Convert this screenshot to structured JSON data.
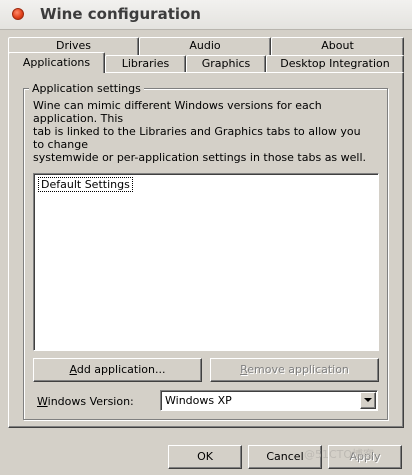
{
  "window": {
    "title": "Wine configuration"
  },
  "tabs": {
    "row1": [
      {
        "label": "Drives"
      },
      {
        "label": "Audio"
      },
      {
        "label": "About"
      }
    ],
    "row2": [
      {
        "label": "Applications",
        "active": true
      },
      {
        "label": "Libraries"
      },
      {
        "label": "Graphics"
      },
      {
        "label": "Desktop Integration"
      }
    ]
  },
  "app_settings": {
    "group_label": "Application settings",
    "description": "Wine can mimic different Windows versions for each application. This\ntab is linked to the Libraries and Graphics tabs to allow you to change\nsystemwide or per-application settings in those tabs as well.",
    "list": [
      {
        "label": "Default Settings",
        "selected": true
      }
    ],
    "add_button_first": "A",
    "add_button_rest": "dd application...",
    "remove_button_first": "R",
    "remove_button_rest": "emove application",
    "version_label_first": "W",
    "version_label_rest": "indows Version:",
    "version_value": "Windows XP"
  },
  "buttons": {
    "ok": "OK",
    "cancel": "Cancel",
    "apply": "Apply"
  },
  "watermark": "@51CTO博客"
}
